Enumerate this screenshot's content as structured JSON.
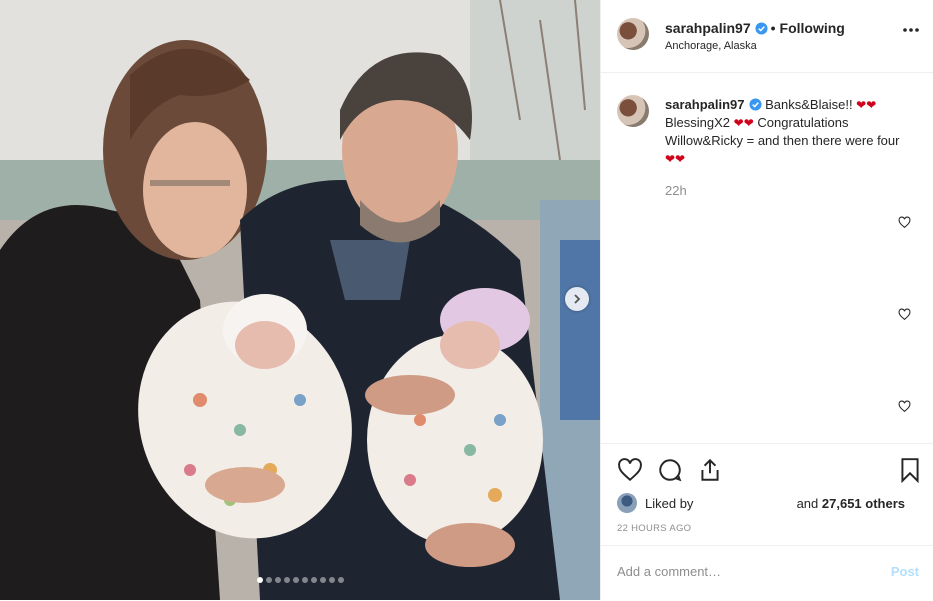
{
  "header": {
    "username": "sarahpalin97",
    "follow_status": "Following",
    "location": "Anchorage, Alaska",
    "separator": "•"
  },
  "caption": {
    "username": "sarahpalin97",
    "parts": [
      "Banks&Blaise!! ",
      "BlessingX2 ",
      "Congratulations Willow&Ricky = and then there were four"
    ],
    "emoji": "❤❤",
    "time_ago": "22h"
  },
  "likes": {
    "liked_by_label": "Liked by",
    "others_prefix": "and",
    "others_count": "27,651 others"
  },
  "timestamp": "22 HOURS AGO",
  "comment": {
    "placeholder": "Add a comment…",
    "post_label": "Post"
  },
  "carousel": {
    "total_slides": 10,
    "active_index": 0
  },
  "colors": {
    "verified_blue": "#3897f0",
    "post_disabled": "#b2dffc",
    "heart_red": "#d0021b",
    "muted": "#8e8e8e"
  },
  "icons": [
    "verified-badge-icon",
    "more-options-icon",
    "heart-icon",
    "comment-icon",
    "share-icon",
    "bookmark-icon",
    "chevron-right-icon"
  ]
}
